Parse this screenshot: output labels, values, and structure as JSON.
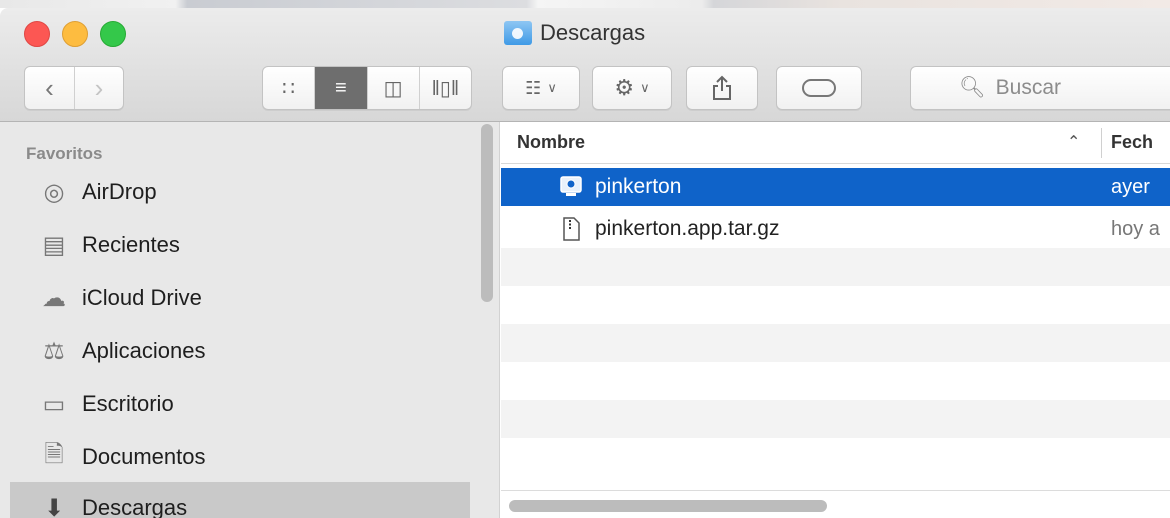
{
  "window": {
    "title": "Descargas"
  },
  "toolbar": {
    "back_icon": "chevron-left-icon",
    "forward_icon": "chevron-right-icon",
    "view_modes": [
      "icon-view",
      "list-view",
      "column-view",
      "cover-flow-view"
    ],
    "active_view": "list-view",
    "search_placeholder": "Buscar"
  },
  "sidebar": {
    "section": "Favoritos",
    "items": [
      {
        "label": "AirDrop",
        "icon": "airdrop-icon"
      },
      {
        "label": "Recientes",
        "icon": "recents-icon"
      },
      {
        "label": "iCloud Drive",
        "icon": "cloud-icon"
      },
      {
        "label": "Aplicaciones",
        "icon": "applications-icon"
      },
      {
        "label": "Escritorio",
        "icon": "desktop-icon"
      },
      {
        "label": "Documentos",
        "icon": "documents-icon"
      },
      {
        "label": "Descargas",
        "icon": "downloads-icon",
        "selected": true
      }
    ]
  },
  "file_list": {
    "columns": {
      "name": "Nombre",
      "date": "Fech"
    },
    "rows": [
      {
        "name": "pinkerton",
        "date": "ayer",
        "icon": "application-icon",
        "selected": true
      },
      {
        "name": "pinkerton.app.tar.gz",
        "date": "hoy a",
        "icon": "archive-icon",
        "selected": false
      }
    ]
  },
  "colors": {
    "selection": "#0f63c9",
    "sidebar_bg": "#e8e8e8"
  }
}
